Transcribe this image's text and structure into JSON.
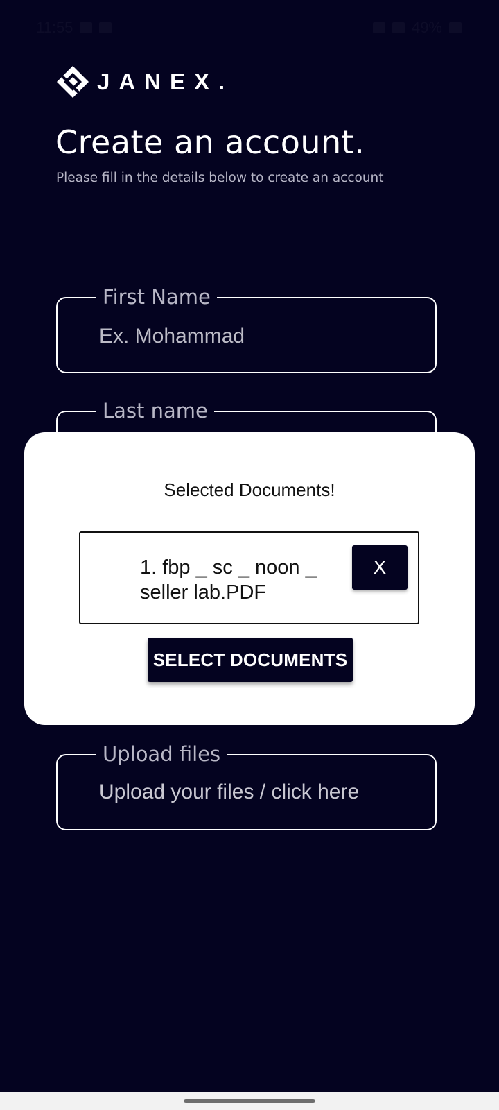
{
  "status_bar": {
    "time": "11:55",
    "battery": "49%"
  },
  "brand": {
    "name": "JANEX.",
    "logo_icon": "janex-diamond-logo"
  },
  "header": {
    "title": "Create an account.",
    "subtitle": "Please fill in the details below to create an account"
  },
  "form": {
    "first_name": {
      "label": "First Name",
      "placeholder": "Ex. Mohammad",
      "value": ""
    },
    "last_name": {
      "label": "Last name"
    },
    "upload": {
      "label": "Upload files",
      "placeholder": "Upload your files / click here"
    }
  },
  "modal": {
    "title": "Selected Documents!",
    "documents": [
      {
        "name": "1. fbp _ sc _ noon _ seller lab.PDF",
        "remove_label": "X"
      }
    ],
    "select_button_label": "SELECT DOCUMENTS"
  },
  "colors": {
    "background": "#040320",
    "button": "#040320",
    "modal": "#ffffff"
  }
}
